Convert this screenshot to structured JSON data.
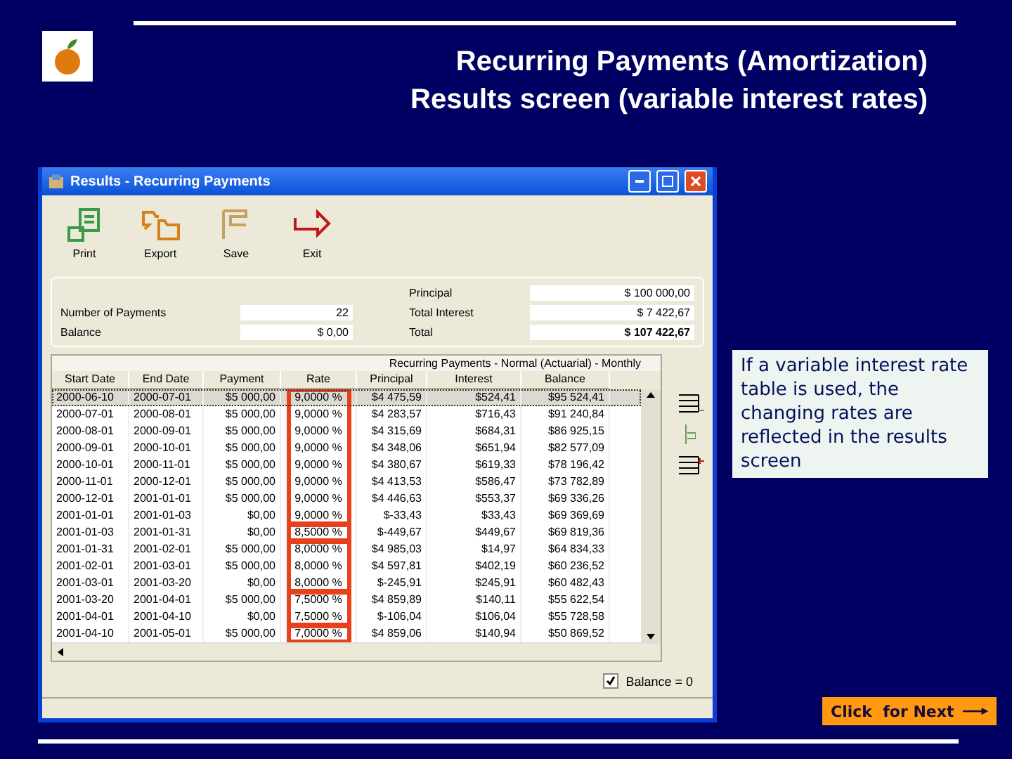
{
  "slide": {
    "title_lines": [
      "Recurring Payments (Amortization)",
      "Results screen (variable interest rates)"
    ],
    "callout": "If a variable interest rate table is used, the changing rates are reflected in the results screen",
    "next_button": {
      "label": "Click  for Next"
    }
  },
  "window": {
    "title": "Results - Recurring Payments",
    "toolbar": [
      {
        "label": "Print",
        "kind": "print"
      },
      {
        "label": "Export",
        "kind": "export"
      },
      {
        "label": "Save",
        "kind": "save"
      },
      {
        "label": "Exit",
        "kind": "exit"
      }
    ],
    "summary": {
      "left": [
        {
          "label": "Number of Payments",
          "value": "22"
        },
        {
          "label": "Balance",
          "value": "$ 0,00"
        }
      ],
      "right": [
        {
          "label": "Principal",
          "value": "$ 100 000,00"
        },
        {
          "label": "Total Interest",
          "value": "$ 7 422,67"
        },
        {
          "label": "Total",
          "value": "$ 107 422,67"
        }
      ]
    },
    "table": {
      "caption": "Recurring Payments - Normal (Actuarial) - Monthly",
      "columns": [
        "Start Date",
        "End Date",
        "Payment",
        "Rate",
        "Principal",
        "Interest",
        "Balance"
      ],
      "row_groups": [
        {
          "highlighted": true,
          "rows": [
            {
              "selected": true,
              "cells": [
                "2000-06-10",
                "2000-07-01",
                "$5 000,00",
                "9,0000 %",
                "$4 475,59",
                "$524,41",
                "$95 524,41"
              ]
            },
            {
              "selected": false,
              "cells": [
                "2000-07-01",
                "2000-08-01",
                "$5 000,00",
                "9,0000 %",
                "$4 283,57",
                "$716,43",
                "$91 240,84"
              ]
            },
            {
              "selected": false,
              "cells": [
                "2000-08-01",
                "2000-09-01",
                "$5 000,00",
                "9,0000 %",
                "$4 315,69",
                "$684,31",
                "$86 925,15"
              ]
            },
            {
              "selected": false,
              "cells": [
                "2000-09-01",
                "2000-10-01",
                "$5 000,00",
                "9,0000 %",
                "$4 348,06",
                "$651,94",
                "$82 577,09"
              ]
            },
            {
              "selected": false,
              "cells": [
                "2000-10-01",
                "2000-11-01",
                "$5 000,00",
                "9,0000 %",
                "$4 380,67",
                "$619,33",
                "$78 196,42"
              ]
            },
            {
              "selected": false,
              "cells": [
                "2000-11-01",
                "2000-12-01",
                "$5 000,00",
                "9,0000 %",
                "$4 413,53",
                "$586,47",
                "$73 782,89"
              ]
            },
            {
              "selected": false,
              "cells": [
                "2000-12-01",
                "2001-01-01",
                "$5 000,00",
                "9,0000 %",
                "$4 446,63",
                "$553,37",
                "$69 336,26"
              ]
            },
            {
              "selected": false,
              "cells": [
                "2001-01-01",
                "2001-01-03",
                "$0,00",
                "9,0000 %",
                "$-33,43",
                "$33,43",
                "$69 369,69"
              ]
            }
          ]
        },
        {
          "highlighted": true,
          "rows": [
            {
              "selected": false,
              "cells": [
                "2001-01-03",
                "2001-01-31",
                "$0,00",
                "8,5000 %",
                "$-449,67",
                "$449,67",
                "$69 819,36"
              ]
            }
          ]
        },
        {
          "highlighted": true,
          "rows": [
            {
              "selected": false,
              "cells": [
                "2001-01-31",
                "2001-02-01",
                "$5 000,00",
                "8,0000 %",
                "$4 985,03",
                "$14,97",
                "$64 834,33"
              ]
            },
            {
              "selected": false,
              "cells": [
                "2001-02-01",
                "2001-03-01",
                "$5 000,00",
                "8,0000 %",
                "$4 597,81",
                "$402,19",
                "$60 236,52"
              ]
            },
            {
              "selected": false,
              "cells": [
                "2001-03-01",
                "2001-03-20",
                "$0,00",
                "8,0000 %",
                "$-245,91",
                "$245,91",
                "$60 482,43"
              ]
            }
          ]
        },
        {
          "highlighted": true,
          "rows": [
            {
              "selected": false,
              "cells": [
                "2001-03-20",
                "2001-04-01",
                "$5 000,00",
                "7,5000 %",
                "$4 859,89",
                "$140,11",
                "$55 622,54"
              ]
            },
            {
              "selected": false,
              "cells": [
                "2001-04-01",
                "2001-04-10",
                "$0,00",
                "7,5000 %",
                "$-106,04",
                "$106,04",
                "$55 728,58"
              ]
            }
          ]
        },
        {
          "highlighted": true,
          "rows": [
            {
              "selected": false,
              "cells": [
                "2001-04-10",
                "2001-05-01",
                "$5 000,00",
                "7,0000 %",
                "$4 859,06",
                "$140,94",
                "$50 869,52"
              ]
            }
          ]
        }
      ]
    },
    "balance_zero": {
      "label": "Balance = 0",
      "checked": true
    }
  }
}
